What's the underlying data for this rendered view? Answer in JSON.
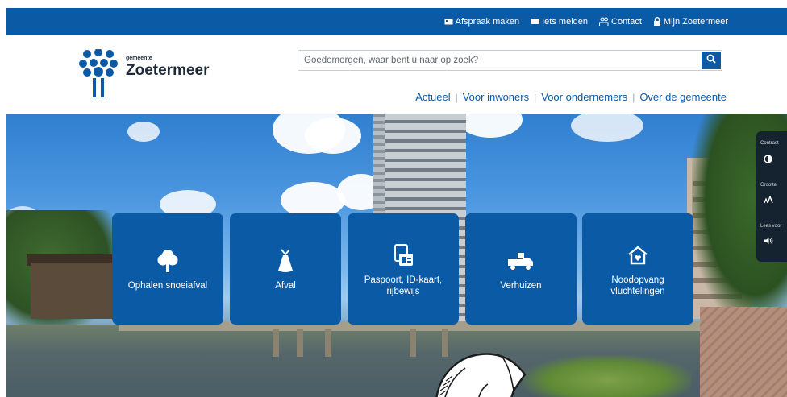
{
  "topbar": {
    "links": [
      {
        "label": "Afspraak maken",
        "icon": "calendar-icon"
      },
      {
        "label": "Iets melden",
        "icon": "message-icon"
      },
      {
        "label": "Contact",
        "icon": "contact-icon"
      },
      {
        "label": "Mijn Zoetermeer",
        "icon": "lock-icon"
      }
    ]
  },
  "logo": {
    "small": "gemeente",
    "name": "Zoetermeer"
  },
  "search": {
    "placeholder": "Goedemorgen, waar bent u naar op zoek?"
  },
  "mainnav": {
    "items": [
      "Actueel",
      "Voor inwoners",
      "Voor ondernemers",
      "Over de gemeente"
    ]
  },
  "tiles": [
    {
      "label": "Ophalen snoeiafval",
      "icon": "tree-icon"
    },
    {
      "label": "Afval",
      "icon": "waste-bag-icon"
    },
    {
      "label": "Paspoort, ID-kaart, rijbewijs",
      "icon": "id-card-icon"
    },
    {
      "label": "Verhuizen",
      "icon": "moving-truck-icon"
    },
    {
      "label": "Noodopvang vluchtelingen",
      "icon": "house-heart-icon"
    }
  ],
  "accessibility": {
    "items": [
      {
        "label": "Contrast",
        "icon": "contrast-icon"
      },
      {
        "label": "Grootte",
        "icon": "text-size-icon"
      },
      {
        "label": "Lees voor",
        "icon": "speaker-icon"
      }
    ]
  },
  "colors": {
    "brand": "#0b5aa5",
    "widget": "#14232f"
  }
}
